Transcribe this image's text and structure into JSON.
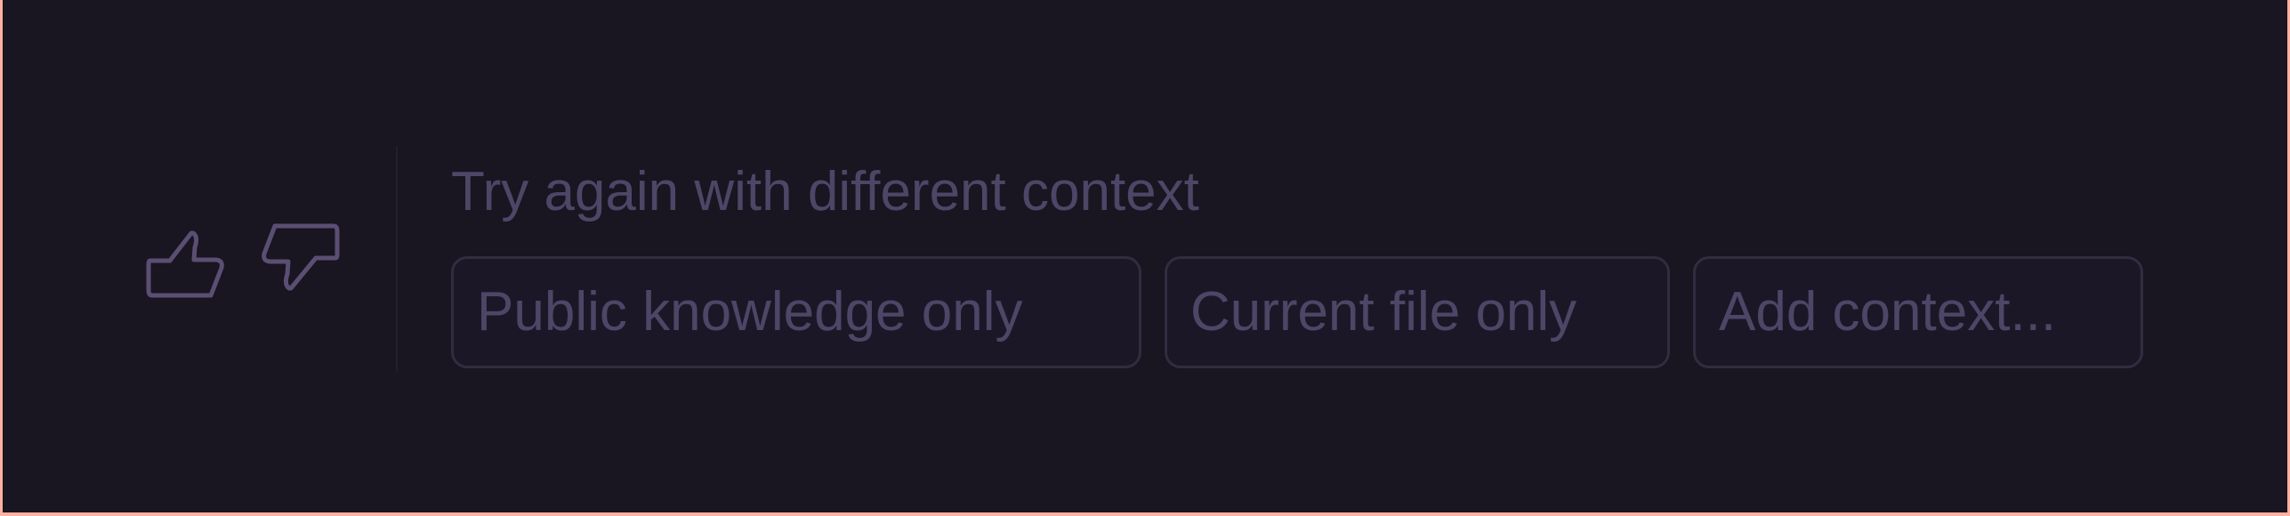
{
  "feedback": {
    "thumbs_up_icon": "thumbs-up-icon",
    "thumbs_down_icon": "thumbs-down-icon"
  },
  "retry": {
    "title": "Try again with different context",
    "options": [
      {
        "label": "Public knowledge only"
      },
      {
        "label": "Current file only"
      },
      {
        "label": "Add context..."
      }
    ]
  },
  "colors": {
    "background": "#191521",
    "text_muted": "#4e4666",
    "chip_border": "#332c40",
    "outer_border": "#ffb0a0"
  }
}
